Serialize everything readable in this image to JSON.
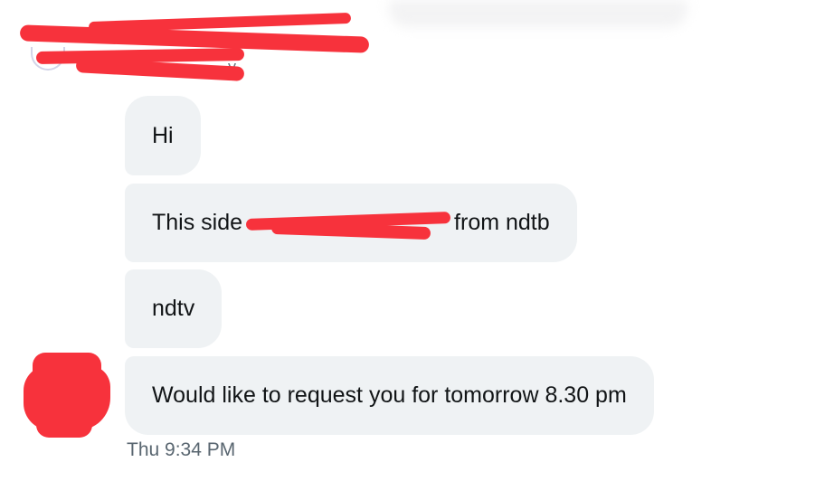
{
  "header": {
    "trailing_text": "y"
  },
  "messages": [
    {
      "text_before": "Hi",
      "text_after": ""
    },
    {
      "text_before": "This side",
      "text_after": "from ndtb"
    },
    {
      "text_before": "ndtv",
      "text_after": ""
    },
    {
      "text_before": "Would like to request you for tomorrow 8.30 pm",
      "text_after": ""
    }
  ],
  "timestamp": "Thu 9:34 PM",
  "colors": {
    "bubble_background": "#eff2f4",
    "redaction": "#f7323c",
    "timestamp_text": "#596670"
  }
}
